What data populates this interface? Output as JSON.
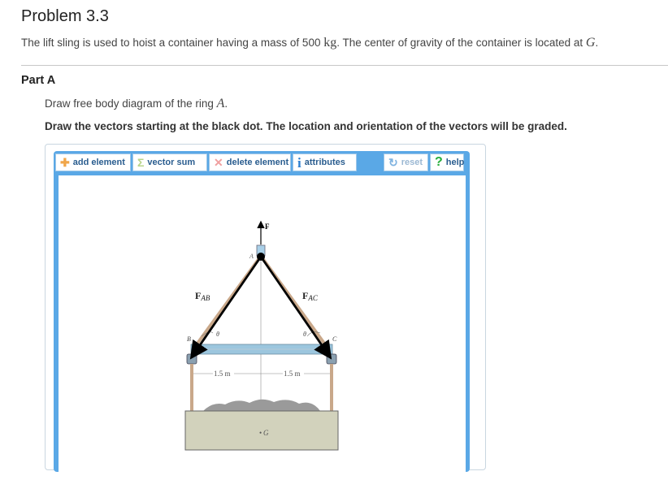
{
  "problem": {
    "title": "Problem 3.3",
    "desc_before": "The lift sling is used to hoist a container having a mass of 500 ",
    "desc_unit": "kg",
    "desc_middle": ". The center of gravity of the container is located at ",
    "desc_var": "G",
    "desc_end": "."
  },
  "part": {
    "label": "Part A",
    "instruction_before": "Draw free body diagram of the ring ",
    "instruction_var": "A",
    "instruction_end": ".",
    "instruction_bold": "Draw the vectors starting at the black dot. The location and orientation of the vectors will be graded."
  },
  "toolbar": {
    "add_element": "add element",
    "vector_sum": "vector sum",
    "delete_element": "delete element",
    "attributes": "attributes",
    "reset": "reset",
    "help": "help"
  },
  "icons": {
    "add": "plus-icon",
    "vector_sum": "sigma-icon",
    "delete": "x-icon",
    "attributes": "info-icon",
    "reset": "reset-icon",
    "help": "help-icon"
  },
  "diagram": {
    "label_F": "F",
    "label_FAB_main": "F",
    "label_FAB_sub": "AB",
    "label_FAC_main": "F",
    "label_FAC_sub": "AC",
    "label_A": "A",
    "label_B": "B",
    "label_C": "C",
    "label_theta": "θ",
    "dim_left": "1.5 m",
    "dim_right": "1.5 m",
    "label_G": "G",
    "colors": {
      "beam": "#9cc6de",
      "container": "#d2d2bc",
      "sling": "#c9a88a",
      "gravel": "#9a9a9a",
      "vector": "#000000"
    }
  }
}
